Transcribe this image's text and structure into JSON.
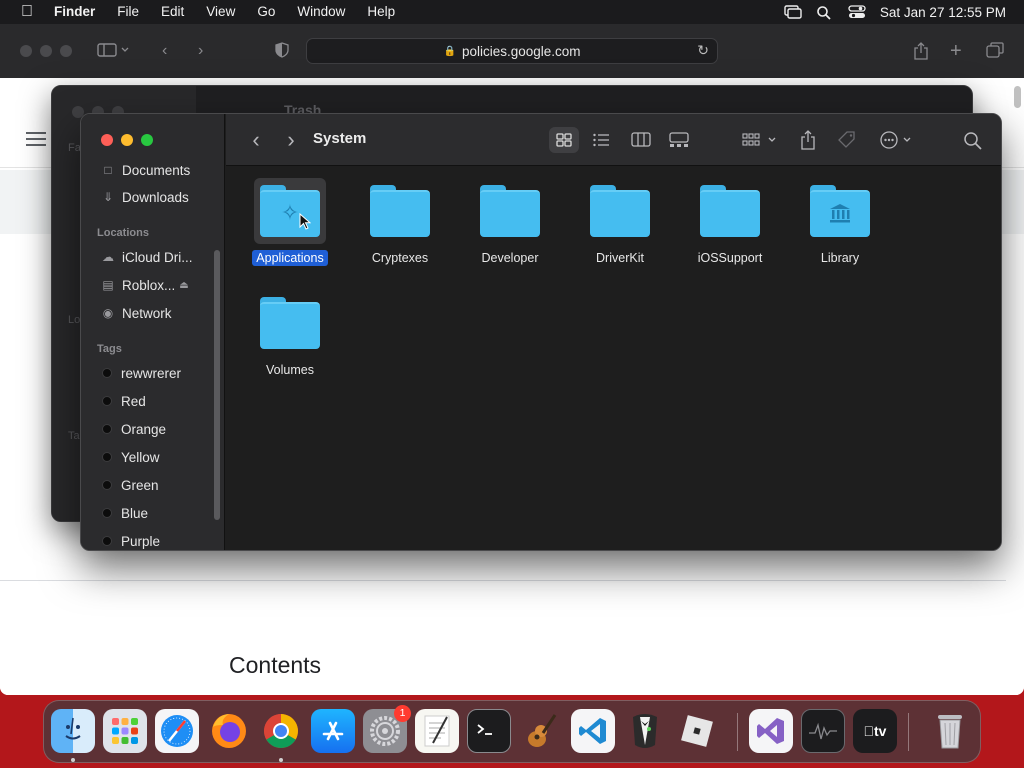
{
  "menubar": {
    "app_name": "Finder",
    "items": [
      "File",
      "Edit",
      "View",
      "Go",
      "Window",
      "Help"
    ],
    "clock": "Sat Jan 27  12:55 PM"
  },
  "safari": {
    "url": "policies.google.com",
    "page_heading": "Contents"
  },
  "trash_window": {
    "title": "Trash",
    "sidebar_fragments": [
      "Fa",
      "Lo",
      "Ta"
    ]
  },
  "finder": {
    "title": "System",
    "sidebar": {
      "favorites": [
        {
          "label": "Documents",
          "icon": "document-icon"
        },
        {
          "label": "Downloads",
          "icon": "downloads-icon"
        }
      ],
      "locations_header": "Locations",
      "locations": [
        {
          "label": "iCloud Dri...",
          "icon": "cloud-icon"
        },
        {
          "label": "Roblox...",
          "icon": "disk-icon",
          "eject": true
        },
        {
          "label": "Network",
          "icon": "network-icon"
        }
      ],
      "tags_header": "Tags",
      "tags": [
        "rewwrerer",
        "Red",
        "Orange",
        "Yellow",
        "Green",
        "Blue",
        "Purple"
      ]
    },
    "items": [
      {
        "label": "Applications",
        "glyph": "app-store-glyph",
        "selected": true
      },
      {
        "label": "Cryptexes"
      },
      {
        "label": "Developer"
      },
      {
        "label": "DriverKit"
      },
      {
        "label": "iOSSupport"
      },
      {
        "label": "Library",
        "glyph": "library-glyph"
      },
      {
        "label": "Volumes"
      }
    ],
    "colors": {
      "folder": "#45bdf0",
      "selection": "#1f5fd6"
    }
  },
  "dock": {
    "apps": [
      "finder-icon",
      "launchpad-icon",
      "safari-icon",
      "firefox-icon",
      "chrome-icon",
      "app-store-icon",
      "system-settings-icon",
      "textedit-icon",
      "terminal-icon",
      "garageband-icon",
      "vscode-icon",
      "tuxedo-icon",
      "roblox-icon",
      "visual-studio-icon",
      "activity-monitor-icon",
      "apple-tv-icon",
      "trash-icon"
    ],
    "settings_badge": "1",
    "tv_label": "tv"
  }
}
